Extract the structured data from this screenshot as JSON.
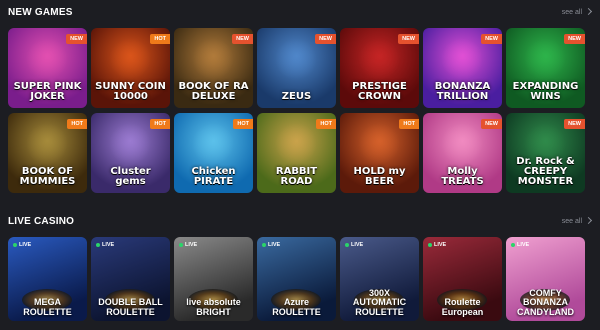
{
  "new_games": {
    "title": "NEW GAMES",
    "see_all": "see all",
    "row1": [
      {
        "name": "SUPER PINK JOKER",
        "badge": "NEW",
        "bg": [
          "#7a1d8c",
          "#e24fb0"
        ]
      },
      {
        "name": "SUNNY COIN 10000",
        "badge": "HOT",
        "bg": [
          "#5a1408",
          "#d9541a"
        ]
      },
      {
        "name": "BOOK OF RA DELUXE",
        "badge": "NEW",
        "bg": [
          "#3a2a12",
          "#b07a3a"
        ]
      },
      {
        "name": "ZEUS",
        "badge": "NEW",
        "bg": [
          "#1a3a6a",
          "#4f86c9"
        ]
      },
      {
        "name": "PRESTIGE CROWN",
        "badge": "NEW",
        "bg": [
          "#5c0a0a",
          "#c42424"
        ]
      },
      {
        "name": "BONANZA TRILLION",
        "badge": "NEW",
        "bg": [
          "#4a1ea0",
          "#e04fd4"
        ]
      },
      {
        "name": "EXPANDING WINS",
        "badge": "NEW",
        "bg": [
          "#0f5a22",
          "#2db34a"
        ]
      }
    ],
    "row2": [
      {
        "name": "BOOK OF MUMMIES",
        "badge": "HOT",
        "bg": [
          "#3d2a0c",
          "#a58a3a"
        ]
      },
      {
        "name": "Cluster gems",
        "badge": "HOT",
        "bg": [
          "#3a2a6a",
          "#9a7ad0"
        ]
      },
      {
        "name": "Chicken PIRATE",
        "badge": "HOT",
        "bg": [
          "#0f6ab0",
          "#5bc0ea"
        ]
      },
      {
        "name": "RABBIT ROAD",
        "badge": "HOT",
        "bg": [
          "#4c6a1a",
          "#c9a24a"
        ]
      },
      {
        "name": "HOLD my BEER",
        "badge": "HOT",
        "bg": [
          "#5c1a0a",
          "#d4602a"
        ]
      },
      {
        "name": "Molly TREATS",
        "badge": "NEW",
        "bg": [
          "#b03a86",
          "#f08ac0"
        ]
      },
      {
        "name": "Dr. Rock & CREEPY MONSTER",
        "badge": "NEW",
        "bg": [
          "#0e3a22",
          "#2f8a4a"
        ]
      }
    ]
  },
  "live_casino": {
    "title": "LIVE CASINO",
    "see_all": "see all",
    "live_label": "LIVE",
    "items": [
      {
        "name": "MEGA ROULETTE",
        "bg": [
          "#0a1a4a",
          "#2a5ac0"
        ]
      },
      {
        "name": "DOUBLE BALL ROULETTE",
        "bg": [
          "#0c1430",
          "#2a3a7a"
        ]
      },
      {
        "name": "live absolute BRIGHT",
        "bg": [
          "#2a2a2a",
          "#8a8a8a"
        ]
      },
      {
        "name": "Azure ROULETTE",
        "bg": [
          "#0a1a3a",
          "#3a6aa0"
        ]
      },
      {
        "name": "300X AUTOMATIC ROULETTE",
        "bg": [
          "#101a3a",
          "#4a5a8a"
        ]
      },
      {
        "name": "Roulette European",
        "bg": [
          "#3a0a10",
          "#9a2a3a"
        ]
      },
      {
        "name": "COMFY BONANZA CANDYLAND",
        "bg": [
          "#b04a9a",
          "#f0a0d0"
        ]
      }
    ]
  }
}
